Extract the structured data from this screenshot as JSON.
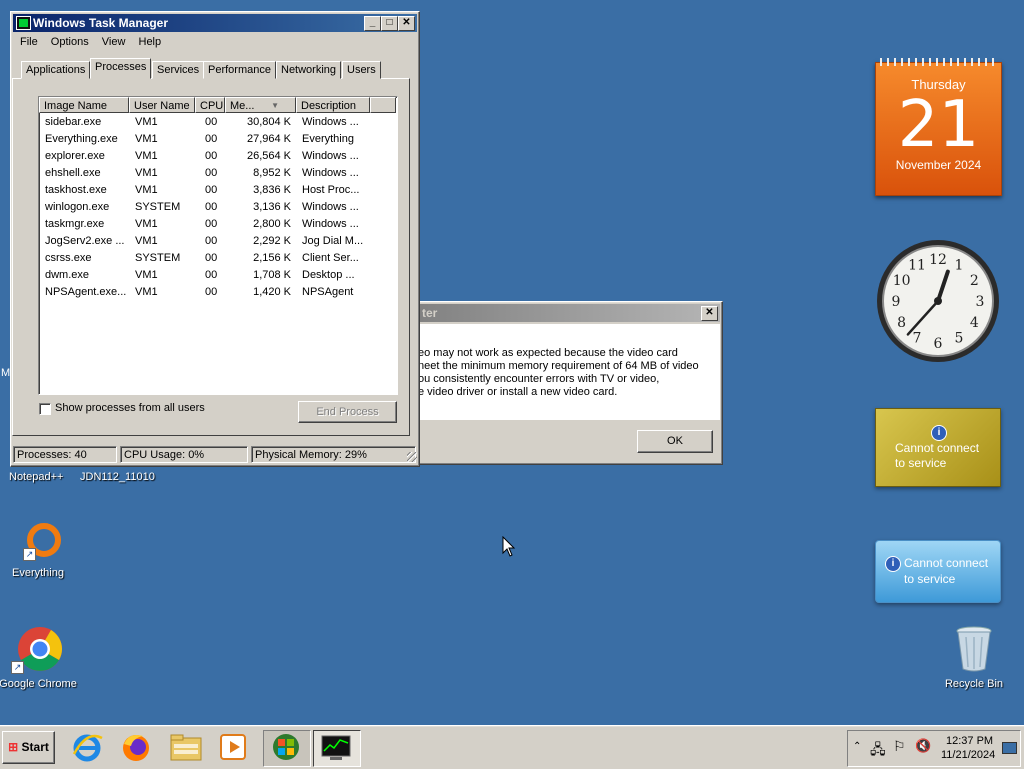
{
  "taskmgr": {
    "title": "Windows Task Manager",
    "menu": [
      "File",
      "Options",
      "View",
      "Help"
    ],
    "tabs": [
      "Applications",
      "Processes",
      "Services",
      "Performance",
      "Networking",
      "Users"
    ],
    "columns": [
      "Image Name",
      "User Name",
      "CPU",
      "Me...",
      "Description"
    ],
    "processes": [
      [
        "sidebar.exe",
        "VM1",
        "00",
        "30,804 K",
        "Windows ..."
      ],
      [
        "Everything.exe",
        "VM1",
        "00",
        "27,964 K",
        "Everything"
      ],
      [
        "explorer.exe",
        "VM1",
        "00",
        "26,564 K",
        "Windows ..."
      ],
      [
        "ehshell.exe",
        "VM1",
        "00",
        "8,952 K",
        "Windows ..."
      ],
      [
        "taskhost.exe",
        "VM1",
        "00",
        "3,836 K",
        "Host Proc..."
      ],
      [
        "winlogon.exe",
        "SYSTEM",
        "00",
        "3,136 K",
        "Windows ..."
      ],
      [
        "taskmgr.exe",
        "VM1",
        "00",
        "2,800 K",
        "Windows ..."
      ],
      [
        "JogServ2.exe ...",
        "VM1",
        "00",
        "2,292 K",
        "Jog Dial M..."
      ],
      [
        "csrss.exe",
        "SYSTEM",
        "00",
        "2,156 K",
        "Client Ser..."
      ],
      [
        "dwm.exe",
        "VM1",
        "00",
        "1,708 K",
        "Desktop ..."
      ],
      [
        "NPSAgent.exe...",
        "VM1",
        "00",
        "1,420 K",
        "NPSAgent"
      ]
    ],
    "show_all_label": "Show processes from all users",
    "end_process_label": "End Process",
    "status": {
      "processes": "Processes: 40",
      "cpu": "CPU Usage: 0%",
      "memory": "Physical Memory: 29%"
    }
  },
  "dialog": {
    "title_fragment": "ter",
    "message_lines": [
      "eo may not work as expected because the video card",
      "neet the minimum memory requirement of 64 MB of video",
      "ou consistently encounter errors with TV or video,",
      "e video driver or install a new video card."
    ],
    "ok_label": "OK"
  },
  "desktop": {
    "left_fragment": "M",
    "labels_row": [
      "Notepad++",
      "JDN112_11010"
    ],
    "icons": [
      {
        "name": "Everything",
        "icon": "everything-icon"
      },
      {
        "name": "Google Chrome",
        "icon": "chrome-icon"
      },
      {
        "name": "Recycle Bin",
        "icon": "recycle-bin-icon"
      }
    ]
  },
  "gadgets": {
    "calendar": {
      "weekday": "Thursday",
      "day": "21",
      "month_year": "November 2024"
    },
    "clock": {
      "hour": 12,
      "minute": 37
    },
    "connect1": {
      "line1": "Cannot connect",
      "line2": "to service"
    },
    "connect2": {
      "line1": "Cannot connect",
      "line2": "to service"
    }
  },
  "taskbar": {
    "start_label": "Start",
    "quicklaunch": [
      "internet-explorer-icon",
      "firefox-icon",
      "explorer-folder-icon",
      "media-player-icon"
    ],
    "time": "12:37 PM",
    "date": "11/21/2024"
  },
  "colors": {
    "desktop": "#3a6ea5",
    "title_active": "#0a246a",
    "calendar": "#e8681a"
  }
}
